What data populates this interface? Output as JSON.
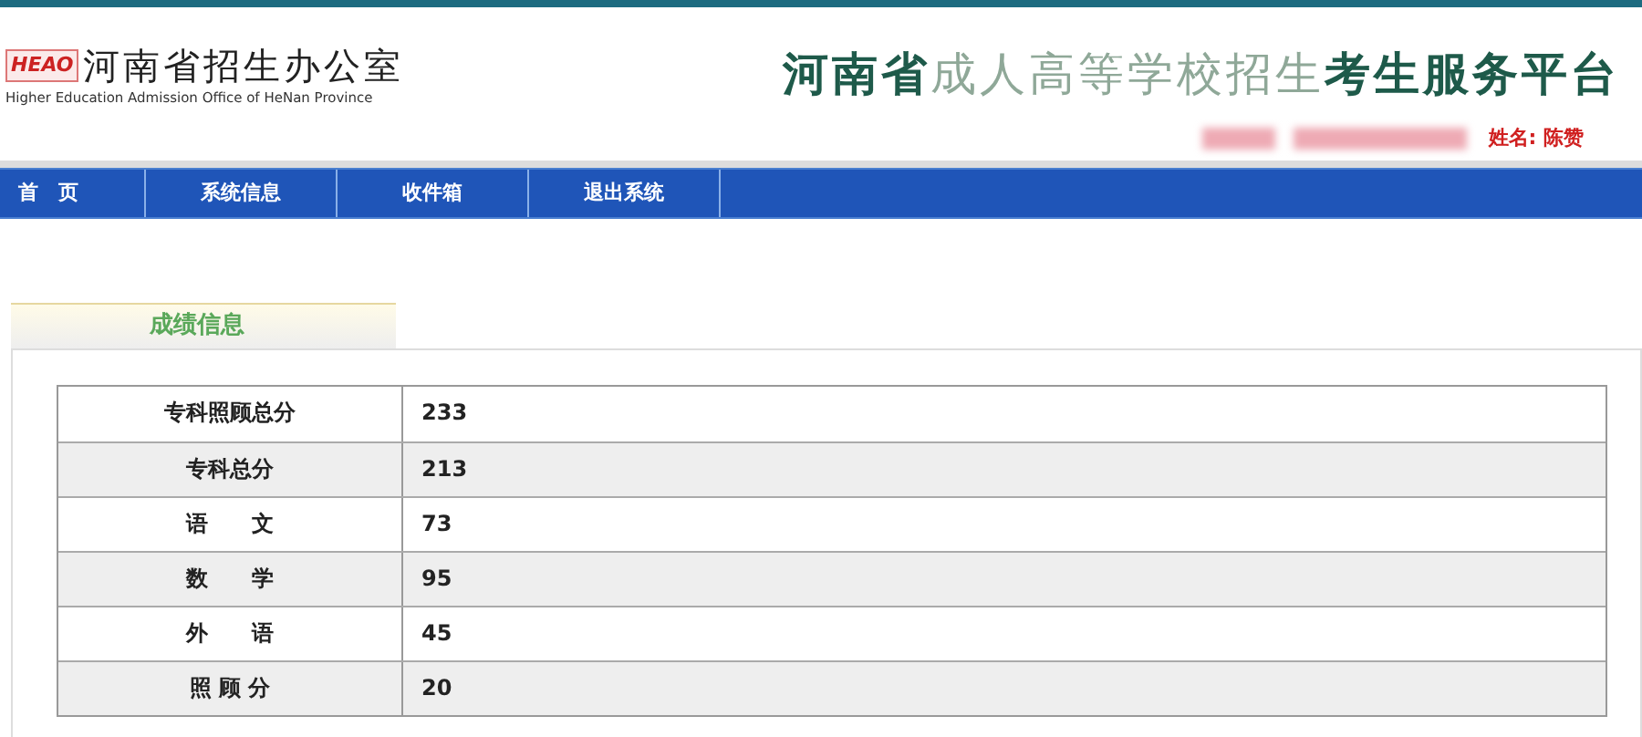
{
  "header": {
    "logo_mark": "HEAO",
    "org_name": "河南省招生办公室",
    "org_name_en": "Higher Education Admission Office of HeNan Province",
    "title_parts": [
      {
        "text": "河南省",
        "kind": "strong"
      },
      {
        "text": "成人高等学校招生",
        "kind": "light"
      },
      {
        "text": "考生服务平台",
        "kind": "strong"
      }
    ],
    "user": "姓名: 陈赞"
  },
  "nav": [
    {
      "label": "首　页"
    },
    {
      "label": "系统信息"
    },
    {
      "label": "收件箱"
    },
    {
      "label": "退出系统"
    }
  ],
  "panel": {
    "tab": "成绩信息",
    "rows": [
      {
        "label": "专科照顾总分",
        "value": "233"
      },
      {
        "label": "专科总分",
        "value": "213"
      },
      {
        "label": "语　　文",
        "value": "73"
      },
      {
        "label": "数　　学",
        "value": "95"
      },
      {
        "label": "外　　语",
        "value": "45"
      },
      {
        "label": "照 顾 分",
        "value": "20"
      }
    ]
  }
}
